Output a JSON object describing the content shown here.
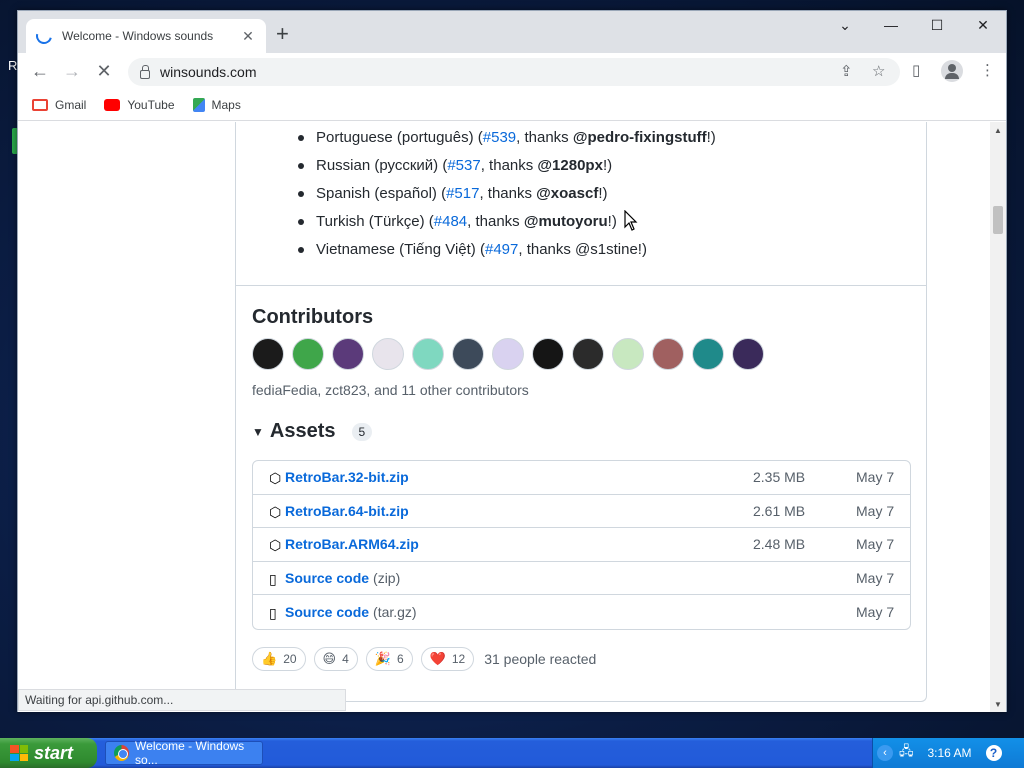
{
  "desktop": {
    "letter": "R"
  },
  "browser": {
    "tab_title": "Welcome - Windows sounds",
    "url": "winsounds.com",
    "bookmarks": [
      {
        "label": "Gmail",
        "icon": "gmail-icon"
      },
      {
        "label": "YouTube",
        "icon": "youtube-icon"
      },
      {
        "label": "Maps",
        "icon": "maps-icon"
      }
    ],
    "status_text": "Waiting for api.github.com..."
  },
  "languages": [
    {
      "name": "Portuguese (português) (",
      "issue": "#539",
      "mid": ", thanks ",
      "user": "@pedro-fixingstuff",
      "end": "!)"
    },
    {
      "name": "Russian (русский) (",
      "issue": "#537",
      "mid": ", thanks ",
      "user": "@1280px",
      "end": "!)"
    },
    {
      "name": "Spanish (español) (",
      "issue": "#517",
      "mid": ", thanks ",
      "user": "@xoascf",
      "end": "!)"
    },
    {
      "name": "Turkish (Türkçe) (",
      "issue": "#484",
      "mid": ", thanks ",
      "user": "@mutoyoru",
      "end": "!)"
    },
    {
      "name": "Vietnamese (Tiếng Việt) (",
      "issue": "#497",
      "mid": ", thanks @s1stine!)",
      "user": "",
      "end": ""
    }
  ],
  "contributors": {
    "title": "Contributors",
    "summary": "fediaFedia, zct823, and 11 other contributors",
    "avatar_colors": [
      "#1b1b1b",
      "#3fa64a",
      "#5b3a7a",
      "#e8e4ec",
      "#7fd8c0",
      "#3d4a5a",
      "#d9d2f0",
      "#151515",
      "#2b2b2b",
      "#c8e8c0",
      "#a06060",
      "#1f8a8a",
      "#3a2a5a"
    ]
  },
  "assets": {
    "title": "Assets",
    "count": "5",
    "items": [
      {
        "name": "RetroBar.32-bit.zip",
        "sub": "",
        "size": "2.35 MB",
        "date": "May 7",
        "icon": "package-icon"
      },
      {
        "name": "RetroBar.64-bit.zip",
        "sub": "",
        "size": "2.61 MB",
        "date": "May 7",
        "icon": "package-icon"
      },
      {
        "name": "RetroBar.ARM64.zip",
        "sub": "",
        "size": "2.48 MB",
        "date": "May 7",
        "icon": "package-icon"
      },
      {
        "name": "Source code",
        "sub": "(zip)",
        "size": "",
        "date": "May 7",
        "icon": "file-zip-icon"
      },
      {
        "name": "Source code",
        "sub": "(tar.gz)",
        "size": "",
        "date": "May 7",
        "icon": "file-zip-icon"
      }
    ]
  },
  "reactions": {
    "items": [
      {
        "emoji": "👍",
        "count": "20"
      },
      {
        "emoji": "😄",
        "count": "4"
      },
      {
        "emoji": "🎉",
        "count": "6"
      },
      {
        "emoji": "❤️",
        "count": "12"
      }
    ],
    "summary": "31 people reacted"
  },
  "taskbar": {
    "start_label": "start",
    "task_label": "Welcome - Windows so...",
    "time": "3:16 AM"
  }
}
